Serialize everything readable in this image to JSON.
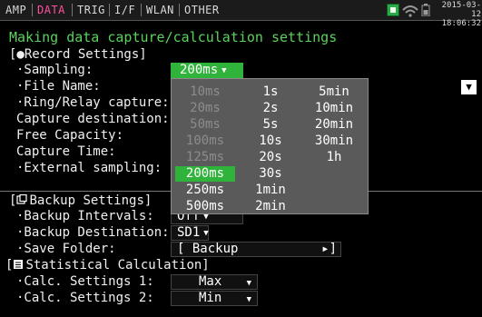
{
  "tabs": [
    "AMP",
    "DATA",
    "TRIG",
    "I/F",
    "WLAN",
    "OTHER"
  ],
  "status": {
    "date": "2015-03-12",
    "time": "18:06:32",
    "sd_icon": "sd-card-icon",
    "wifi_icon": "wifi-icon",
    "battery_icon": "battery-icon"
  },
  "page_title": "Making data capture/calculation settings",
  "record_section": {
    "header": "[●Record Settings]",
    "items": [
      {
        "label": "·Sampling:",
        "value": "200ms"
      },
      {
        "label": "·File Name:"
      },
      {
        "label": "·Ring/Relay capture:"
      },
      {
        "label": " Capture destination:"
      },
      {
        "label": " Free Capacity:"
      },
      {
        "label": " Capture Time:"
      },
      {
        "label": "·External sampling:"
      }
    ]
  },
  "backup_section": {
    "header": "[",
    "header_text": "Backup Settings]",
    "intervals_label": "·Backup Intervals:",
    "intervals_value": "Off",
    "destination_label": "·Backup Destination:",
    "destination_value": "SD1",
    "folder_label": "·Save Folder:",
    "folder_value": "[ Backup",
    "folder_end": "▸]"
  },
  "stats_section": {
    "header": "[",
    "header_text": "Statistical Calculation]",
    "calc1_label": "·Calc. Settings 1:",
    "calc1_value": "Max",
    "calc2_label": "·Calc. Settings 2:",
    "calc2_value": "Min"
  },
  "popup": {
    "columns": [
      [
        {
          "label": "10ms",
          "state": "disabled"
        },
        {
          "label": "20ms",
          "state": "disabled"
        },
        {
          "label": "50ms",
          "state": "disabled"
        },
        {
          "label": "100ms",
          "state": "disabled"
        },
        {
          "label": "125ms",
          "state": "disabled"
        },
        {
          "label": "200ms",
          "state": "selected"
        },
        {
          "label": "250ms",
          "state": "normal"
        },
        {
          "label": "500ms",
          "state": "normal"
        }
      ],
      [
        {
          "label": "1s",
          "state": "normal"
        },
        {
          "label": "2s",
          "state": "normal"
        },
        {
          "label": "5s",
          "state": "normal"
        },
        {
          "label": "10s",
          "state": "normal"
        },
        {
          "label": "20s",
          "state": "normal"
        },
        {
          "label": "30s",
          "state": "normal"
        },
        {
          "label": "1min",
          "state": "normal"
        },
        {
          "label": "2min",
          "state": "normal"
        }
      ],
      [
        {
          "label": "5min",
          "state": "normal"
        },
        {
          "label": "10min",
          "state": "normal"
        },
        {
          "label": "20min",
          "state": "normal"
        },
        {
          "label": "30min",
          "state": "normal"
        },
        {
          "label": "1h",
          "state": "normal"
        }
      ]
    ]
  },
  "icons": {
    "dropdown": "chevron-down-icon",
    "scroll": "scroll-down-icon",
    "record": "record-icon",
    "backup": "backup-icon",
    "stats": "stats-icon"
  },
  "colors": {
    "accent_green": "#2fb33b",
    "title_green": "#5ad25a",
    "active_tab": "#ff4fa0",
    "popup_bg": "#5a5a5a",
    "disabled_text": "#8c8c8c"
  },
  "scroll_button": "▼"
}
